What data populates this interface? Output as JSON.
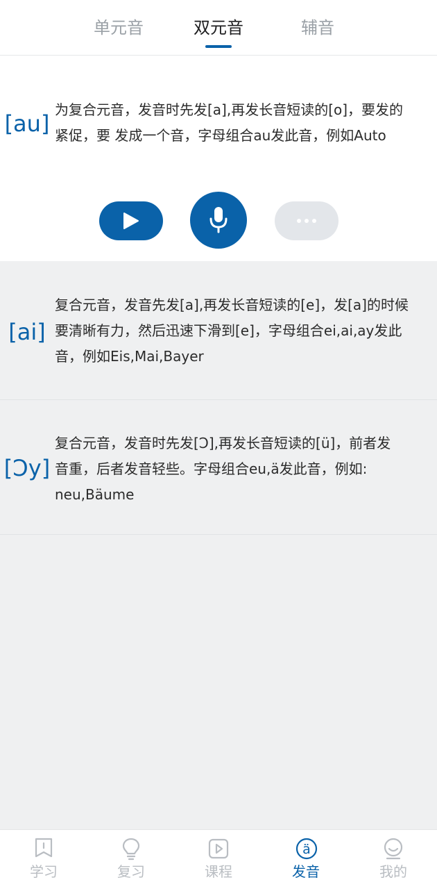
{
  "tabs": [
    {
      "label": "单元音"
    },
    {
      "label": "双元音"
    },
    {
      "label": "辅音"
    }
  ],
  "current": {
    "symbol": "[au]",
    "lines": [
      "为复合元音，发音时先发[a],再发长音短读的[o]，要发的",
      "紧促，要 发成一个音，字母组合au发此音，例如Auto"
    ]
  },
  "controls": {
    "play": "play-icon",
    "record": "microphone-icon",
    "more": "more-dots-icon"
  },
  "list": [
    {
      "symbol": "[ai]",
      "lines": [
        "复合元音，发音先发[a],再发长音短读的[e]，发[a]的时候",
        "要清晰有力，然后迅速下滑到[e]，字母组合ei,ai,ay发此",
        "音，例如Eis,Mai,Bayer"
      ]
    },
    {
      "symbol": "[Ɔy]",
      "lines": [
        "复合元音，发音时先发[Ɔ],再发长音短读的[ü]，前者发",
        "音重，后者发音轻些。字母组合eu,ä发此音，例如:",
        "neu,Bäume"
      ]
    }
  ],
  "bottom_nav": [
    {
      "label": "学习",
      "icon": "bookmark-icon"
    },
    {
      "label": "复习",
      "icon": "lightbulb-icon"
    },
    {
      "label": "课程",
      "icon": "video-play-icon"
    },
    {
      "label": "发音",
      "icon": "umlaut-a-icon",
      "icon_glyph": "ä"
    },
    {
      "label": "我的",
      "icon": "smiley-icon"
    }
  ],
  "colors": {
    "accent": "#0a62a9",
    "inactive": "#b9bdc2",
    "background": "#eff0f1"
  }
}
